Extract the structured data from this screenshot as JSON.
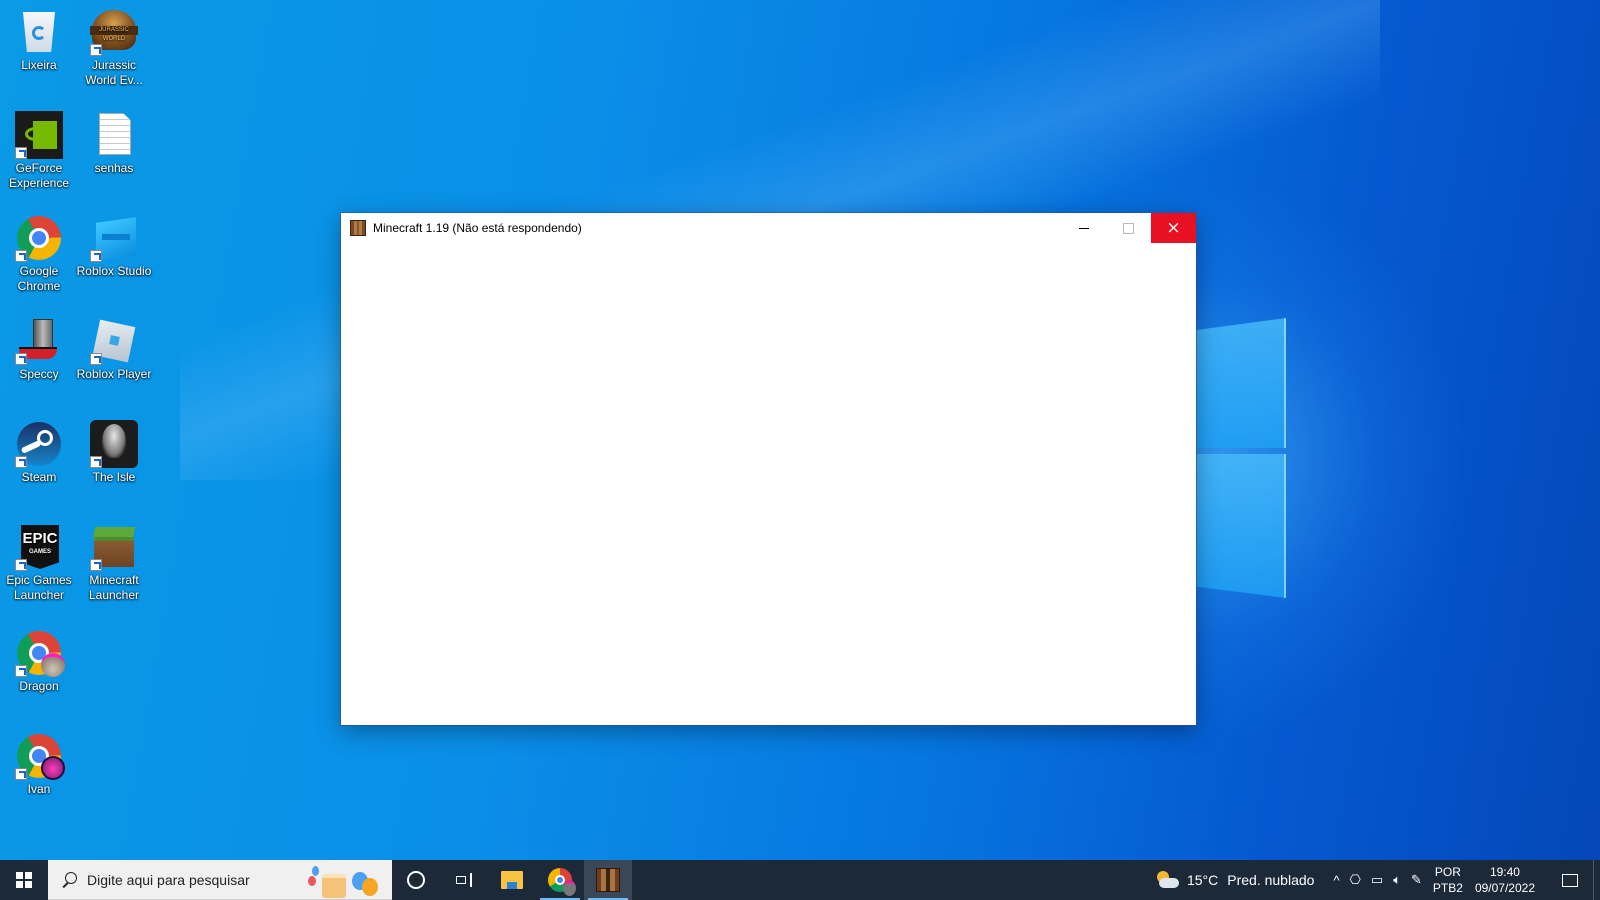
{
  "desktop": {
    "icons": [
      {
        "label": "Lixeira",
        "icon": "recycle-bin-icon"
      },
      {
        "label": "Jurassic World Ev...",
        "icon": "jurassic-world-icon"
      },
      {
        "label": "GeForce Experience",
        "icon": "geforce-icon"
      },
      {
        "label": "senhas",
        "icon": "text-file-icon"
      },
      {
        "label": "Google Chrome",
        "icon": "chrome-icon"
      },
      {
        "label": "Roblox Studio",
        "icon": "roblox-studio-icon"
      },
      {
        "label": "Speccy",
        "icon": "speccy-icon"
      },
      {
        "label": "Roblox Player",
        "icon": "roblox-player-icon"
      },
      {
        "label": "Steam",
        "icon": "steam-icon"
      },
      {
        "label": "The Isle",
        "icon": "the-isle-icon"
      },
      {
        "label": "Epic Games Launcher",
        "icon": "epic-games-icon"
      },
      {
        "label": "Minecraft Launcher",
        "icon": "minecraft-launcher-icon"
      },
      {
        "label": "Dragon",
        "icon": "chrome-profile-icon"
      },
      {
        "label": "Ivan",
        "icon": "chrome-profile-icon"
      }
    ]
  },
  "window": {
    "title": "Minecraft 1.19 (Não está respondendo)",
    "icon": "minecraft-icon",
    "buttons": {
      "minimize": "minimize",
      "maximize": "maximize",
      "close": "×"
    },
    "close_color": "#e81123"
  },
  "taskbar": {
    "search_placeholder": "Digite aqui para pesquisar",
    "apps": [
      "cortana",
      "task-view",
      "file-explorer",
      "chrome",
      "minecraft"
    ],
    "weather": {
      "temp": "15°C",
      "condition": "Pred. nublado"
    },
    "language": {
      "line1": "POR",
      "line2": "PTB2"
    },
    "clock": {
      "time": "19:40",
      "date": "09/07/2022"
    },
    "tray_icons": {
      "chevron": "^",
      "meet": "⎔",
      "network": "▭",
      "volume": "🔈︎",
      "pen": "✎"
    },
    "accent": "#76b9ed",
    "background": "#1b2939"
  }
}
